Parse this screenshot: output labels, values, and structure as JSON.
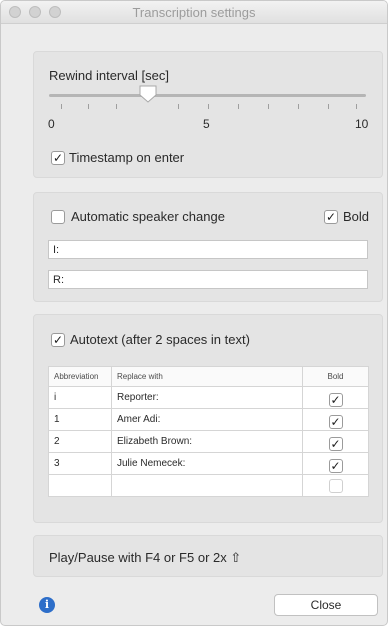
{
  "window": {
    "title": "Transcription settings"
  },
  "rewind": {
    "label": "Rewind interval [sec]",
    "min_label": "0",
    "mid_label": "5",
    "max_label": "10",
    "value": 3,
    "timestamp_label": "Timestamp on enter",
    "timestamp_checked": true
  },
  "speaker": {
    "auto_label": "Automatic speaker change",
    "auto_checked": false,
    "bold_label": "Bold",
    "bold_checked": true,
    "interviewer_value": "I:",
    "respondent_value": "R:"
  },
  "autotext": {
    "label": "Autotext (after 2 spaces in text)",
    "checked": true,
    "columns": [
      "Abbreviation",
      "Replace with",
      "Bold"
    ],
    "rows": [
      {
        "abbr": "i",
        "replace": "Reporter:",
        "bold": true
      },
      {
        "abbr": "1",
        "replace": "Amer Adi:",
        "bold": true
      },
      {
        "abbr": "2",
        "replace": "Elizabeth Brown:",
        "bold": true
      },
      {
        "abbr": "3",
        "replace": "Julie Nemecek:",
        "bold": true
      },
      {
        "abbr": "",
        "replace": "",
        "bold": false
      }
    ]
  },
  "playpause": {
    "label": "Play/Pause with F4 or F5 or 2x ⇧"
  },
  "footer": {
    "info_icon": "info-icon",
    "close_label": "Close"
  }
}
